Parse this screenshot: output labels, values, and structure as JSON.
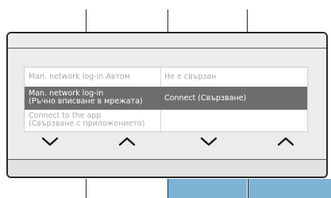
{
  "menu": {
    "rows": [
      {
        "left": "Man. network log-in Автом",
        "right": "Не е свързан",
        "selected": false
      },
      {
        "left_line1": "Man. network log-in",
        "left_line2": "(Ръчно вписване в мрежата)",
        "right": "Connect (Свързване)",
        "selected": true
      },
      {
        "left_line1": "Connect to the app",
        "left_line2": "(Свързване с приложението)",
        "selected": false
      }
    ]
  },
  "nav": {
    "buttons": [
      "chevron-down-icon",
      "chevron-up-icon",
      "chevron-down-icon",
      "chevron-up-icon"
    ]
  },
  "colors": {
    "selected_row": "#6d6d6d",
    "panel_bg": "#ececec",
    "accent_blue": "#7fb3d6",
    "border": "#2a2a2a"
  }
}
